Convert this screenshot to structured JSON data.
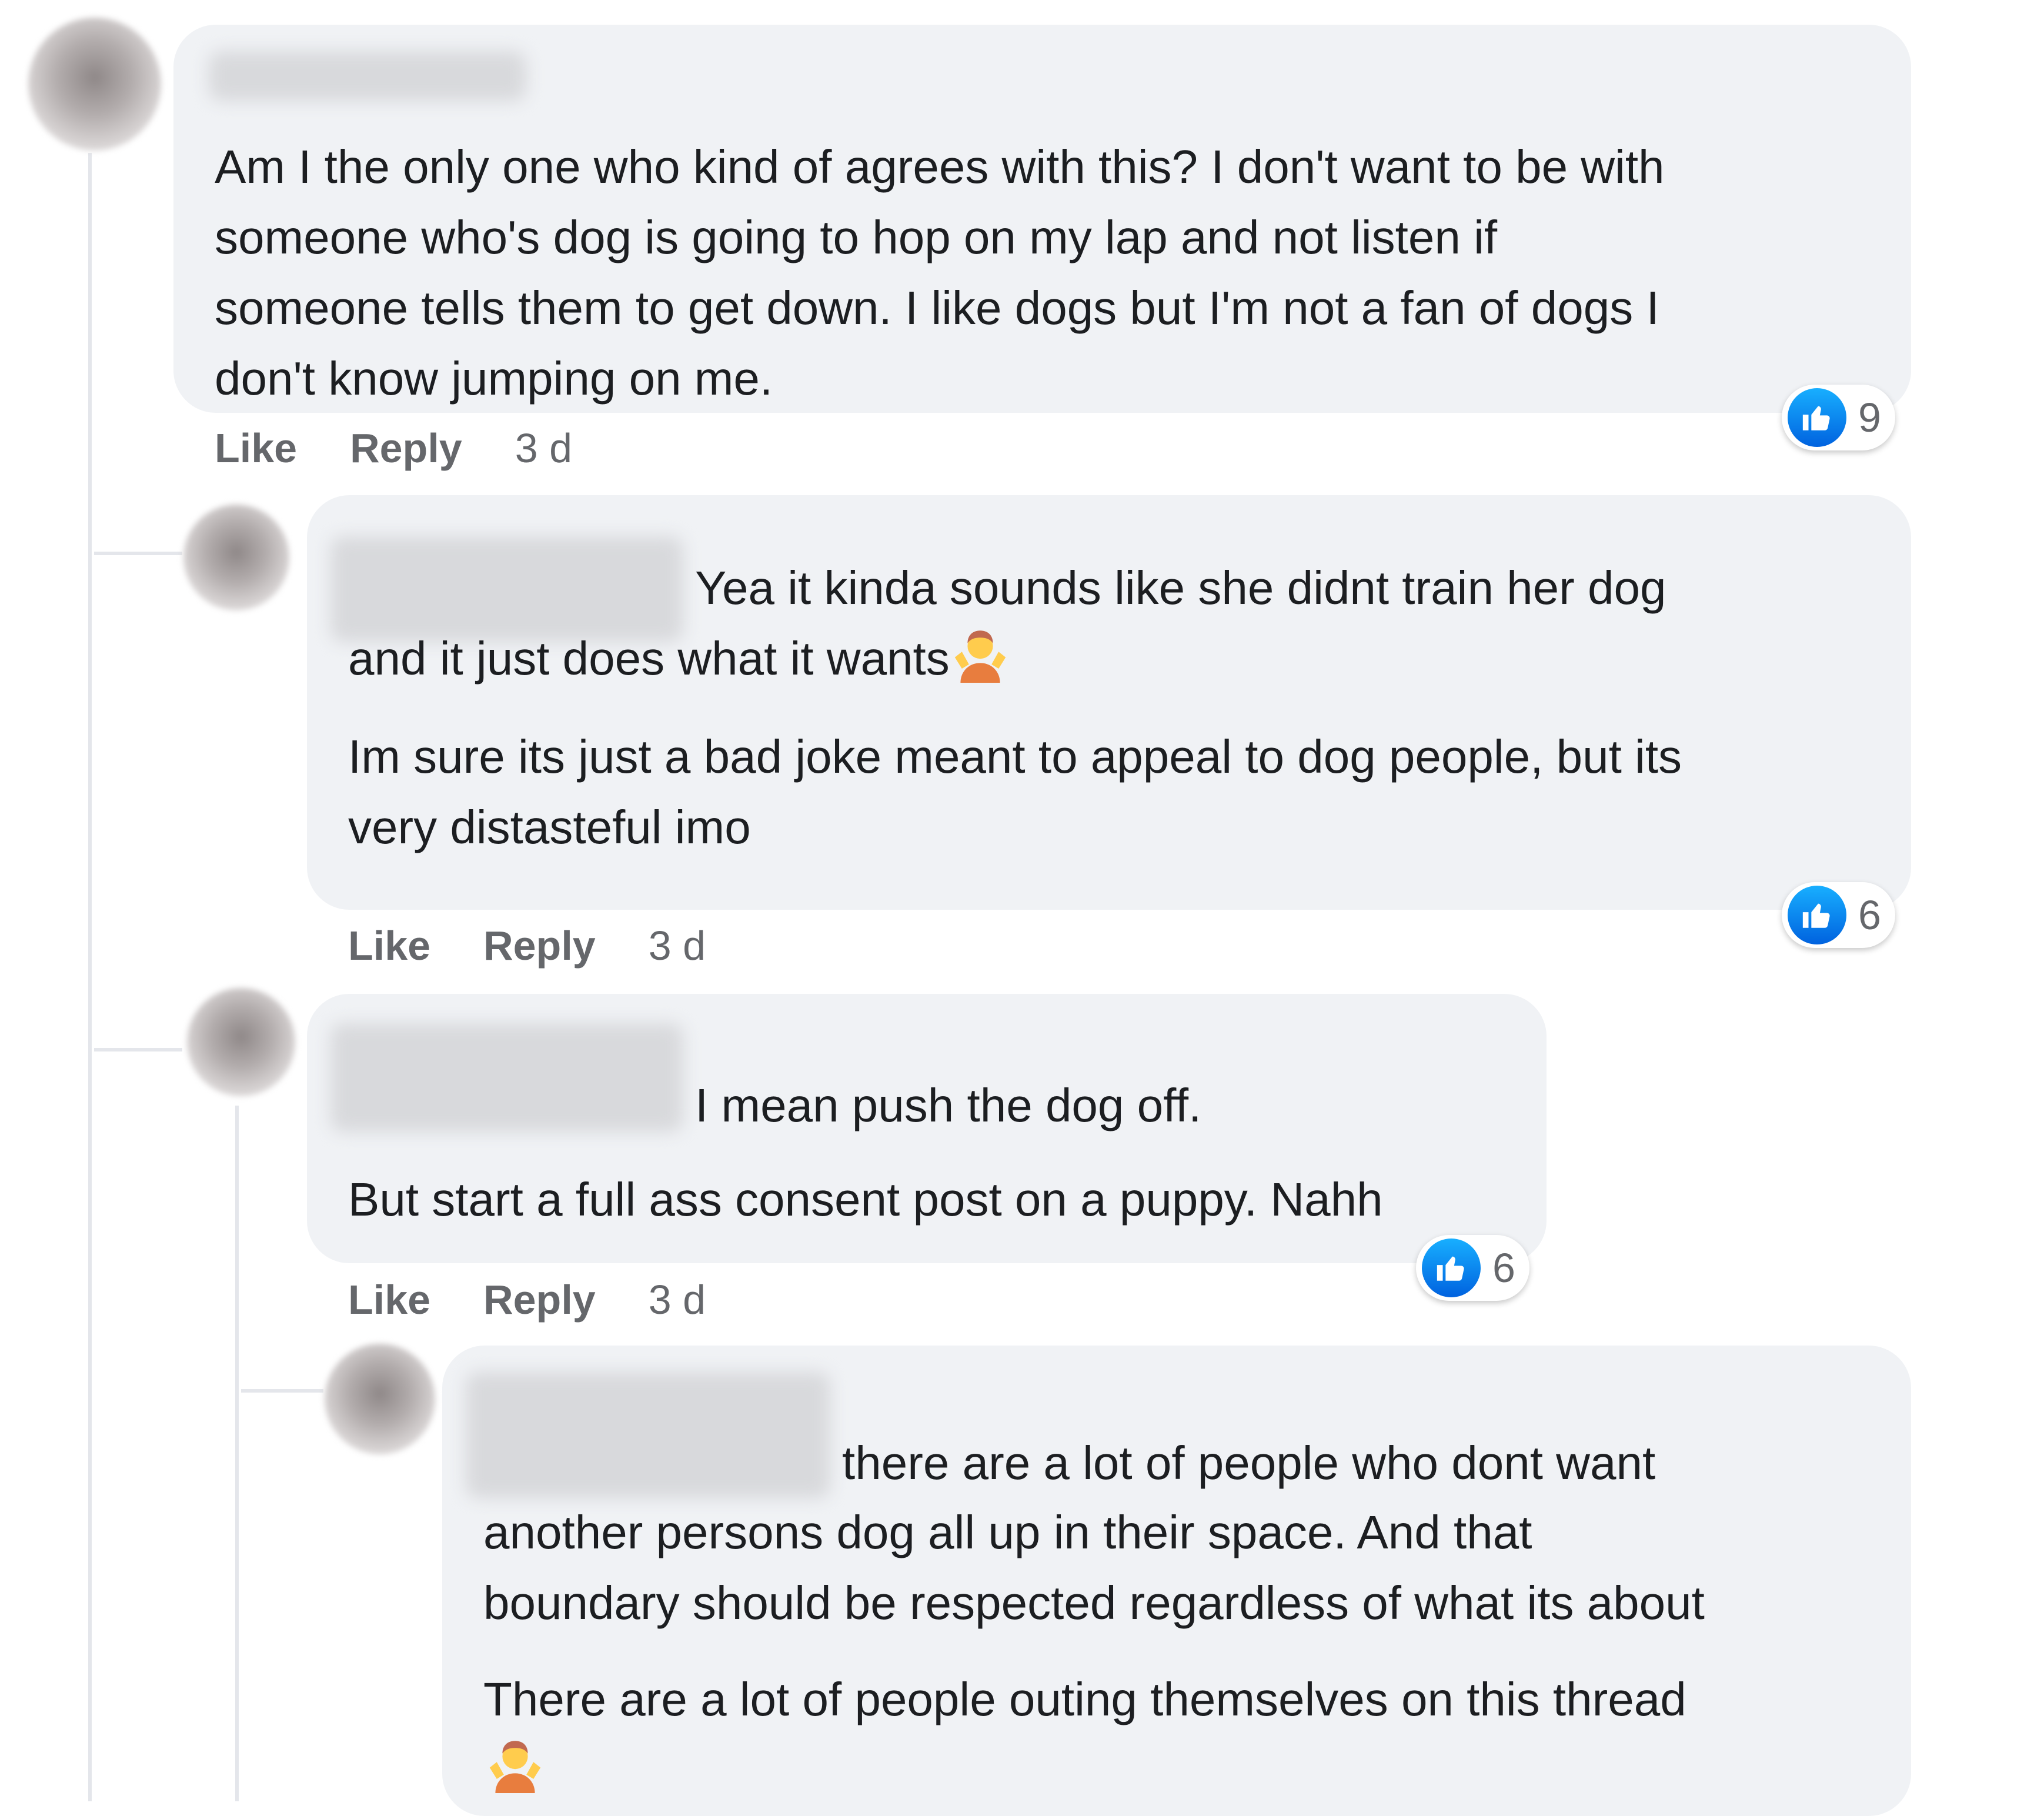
{
  "comments": [
    {
      "lines": [
        "Am I the only one who kind of agrees with this? I don't want to be with",
        "someone who's dog is going to hop on my lap and not listen if",
        "someone tells them to get down. I like dogs but I'm not a fan of dogs I",
        "don't know jumping on me."
      ],
      "like_count": "9",
      "time": "3 d"
    },
    {
      "lines": [
        "Yea it kinda sounds like she didnt train her dog",
        "and it just does what it wants",
        "Im sure its just a bad joke meant to appeal to dog people, but its",
        "very distasteful imo"
      ],
      "like_count": "6",
      "time": "3 d"
    },
    {
      "lines": [
        "I mean push the dog off.",
        "But start a full ass consent post on a puppy. Nahh"
      ],
      "like_count": "6",
      "time": "3 d"
    },
    {
      "lines": [
        "there are a lot of people who dont want",
        "another persons dog all up in their space. And that",
        "boundary should be respected regardless of what its about",
        "There are a lot of people outing themselves on this thread"
      ]
    }
  ],
  "actions": {
    "like_label": "Like",
    "reply_label": "Reply"
  },
  "icons": {
    "reaction": "thumbs-up-icon",
    "emoji": "person-shrugging-emoji"
  },
  "colors": {
    "bubble_bg": "#f0f2f5",
    "like_blue": "#0866ff",
    "meta_text": "#65676b"
  }
}
